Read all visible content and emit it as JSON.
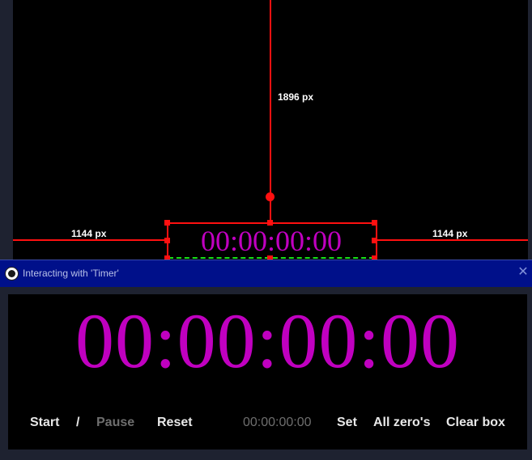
{
  "preview": {
    "timer_text": "00:00:00:00",
    "top_distance": "1896 px",
    "left_distance": "1144 px",
    "right_distance": "1144 px"
  },
  "window": {
    "title": "Interacting with 'Timer'",
    "close_icon": "close-icon",
    "app_icon": "obs-logo-icon"
  },
  "timer": {
    "display": "00:00:00:00",
    "color": "#c000c0"
  },
  "controls": {
    "start": "Start",
    "separator": "/",
    "pause": "Pause",
    "reset": "Reset",
    "time_input": "00:00:00:00",
    "set": "Set",
    "all_zeros": "All zero's",
    "clear_box": "Clear box"
  }
}
